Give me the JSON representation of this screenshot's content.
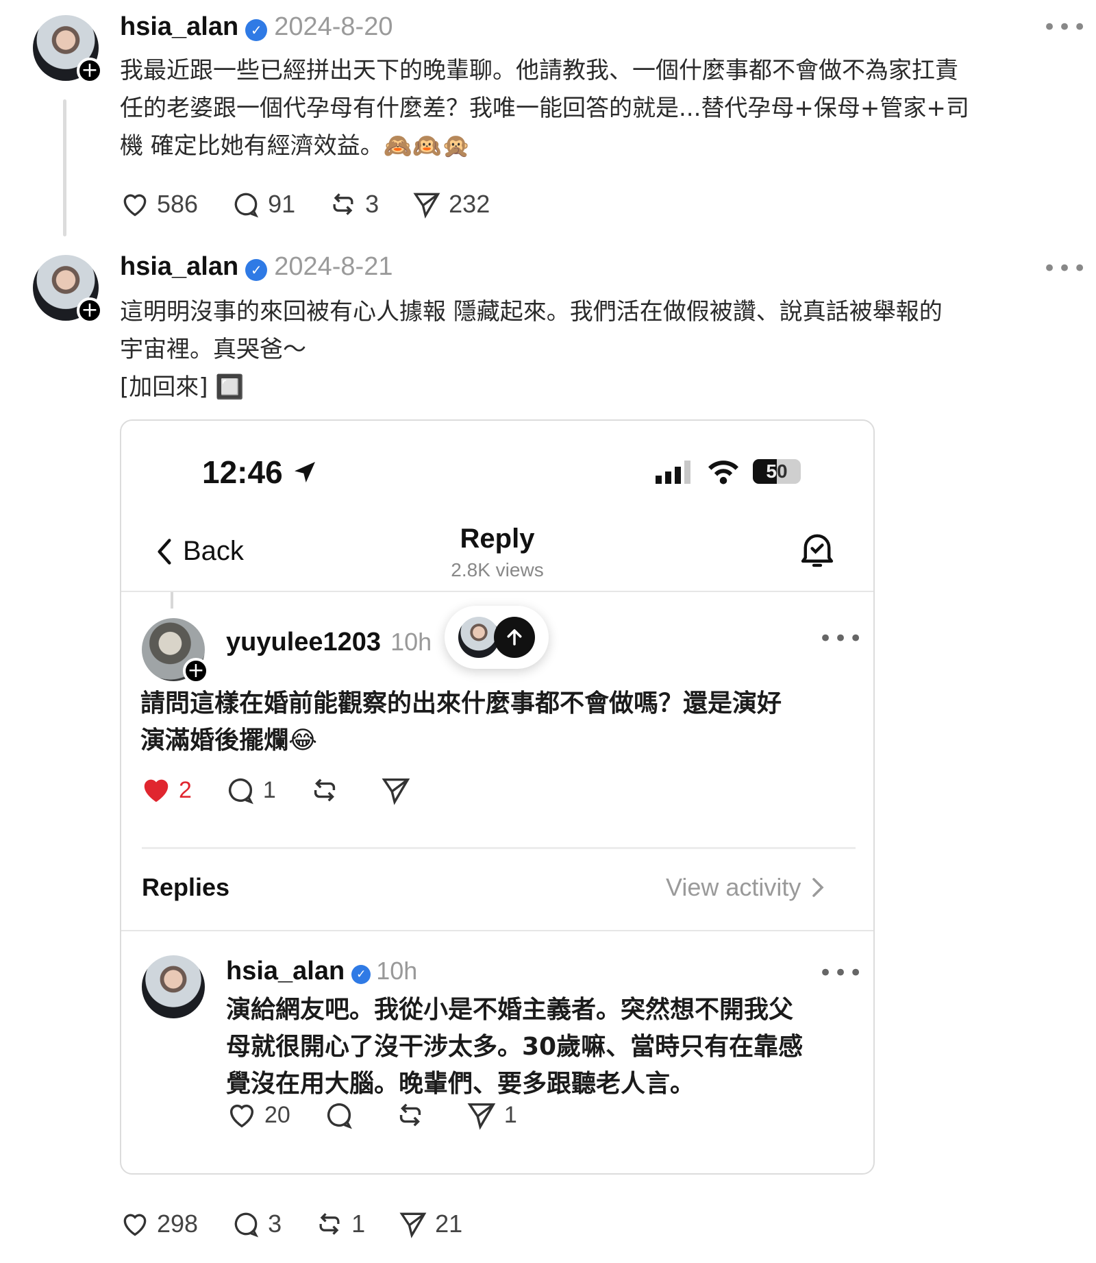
{
  "posts": [
    {
      "username": "hsia_alan",
      "verified_icon": "verified-badge-icon",
      "date": "2024-8-20",
      "text_lines": [
        "我最近跟一些已經拼出天下的晚輩聊。他請教我、一個什麼事都不會做不為家扛責",
        "任的老婆跟一個代孕母有什麼差？我唯一能回答的就是...替代孕母+保母+管家+司",
        "機 確定比她有經濟效益。🙈🙉🙊"
      ],
      "likes": "586",
      "comments": "91",
      "reposts": "3",
      "shares": "232"
    },
    {
      "username": "hsia_alan",
      "date": "2024-8-21",
      "text_lines": [
        "這明明沒事的來回被有心人據報 隱藏起來。我們活在做假被讚、說真話被舉報的",
        "宇宙裡。真哭爸～",
        "[加回來] 🔲"
      ],
      "likes": "298",
      "comments": "3",
      "reposts": "1",
      "shares": "21"
    }
  ],
  "screenshot": {
    "status_time": "12:46",
    "battery": "50",
    "back_label": "Back",
    "title": "Reply",
    "views": "2.8K views",
    "original_comment": {
      "username": "yuyulee1203",
      "time": "10h",
      "text_lines": [
        "請問這樣在婚前能觀察的出來什麼事都不會做嗎？還是演好",
        "演滿婚後擺爛😂"
      ],
      "likes": "2",
      "comments": "1"
    },
    "replies_header": "Replies",
    "view_activity": "View activity",
    "reply": {
      "username": "hsia_alan",
      "time": "10h",
      "text_lines": [
        "演給網友吧。我從小是不婚主義者。突然想不開我父",
        "母就很開心了沒干涉太多。30歲嘛、當時只有在靠感",
        "覺沒在用大腦。晚輩們、要多跟聽老人言。"
      ],
      "likes": "20",
      "shares": "1"
    }
  },
  "colors": {
    "verified": "#2f7ae5",
    "liked_heart": "#e0262f",
    "muted_text": "#9a9a9a"
  }
}
